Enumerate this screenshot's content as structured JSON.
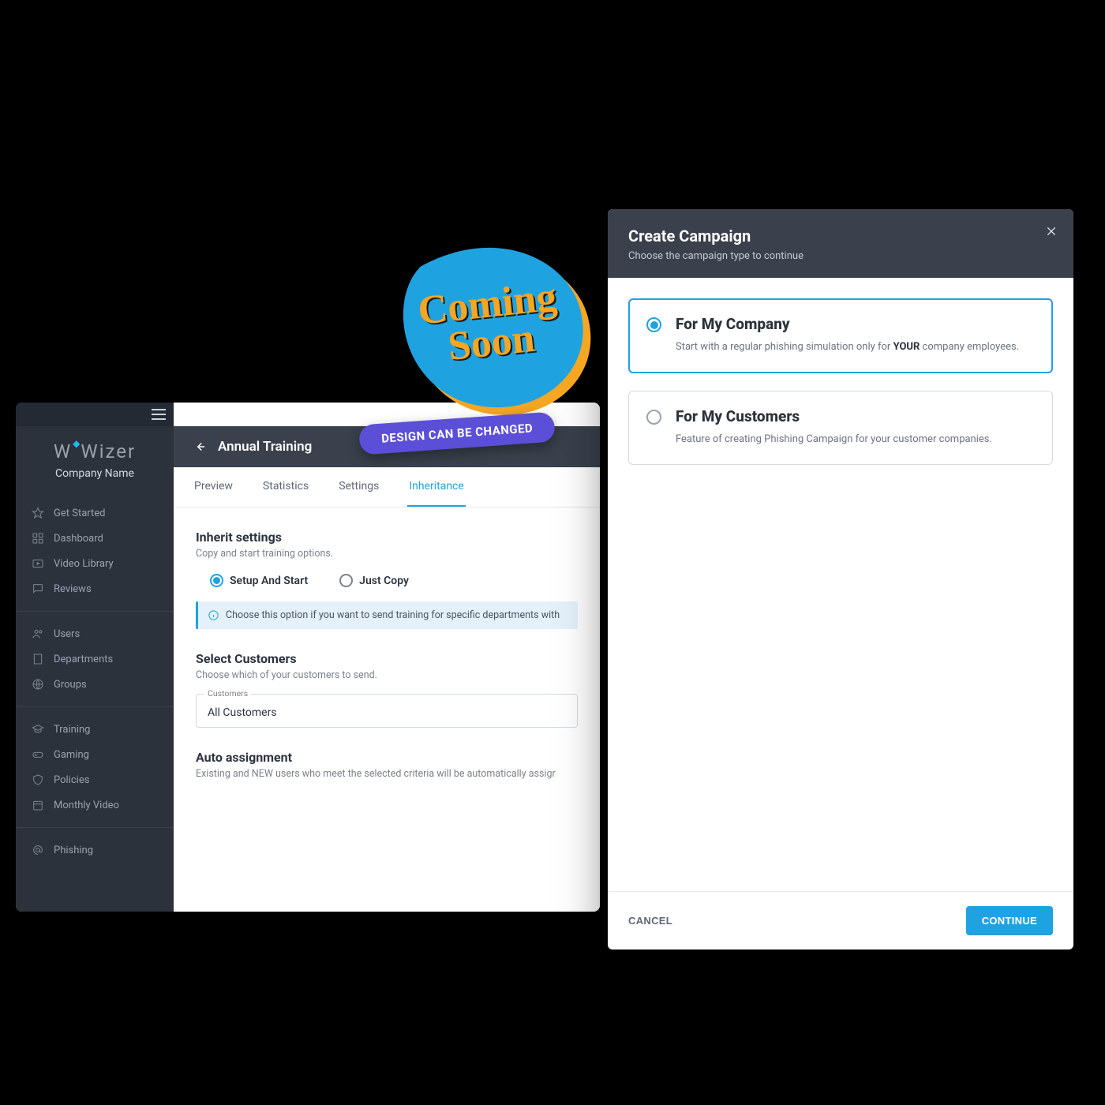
{
  "brand": {
    "name": "Wizer"
  },
  "company_name": "Company Name",
  "sidebar": {
    "groups": [
      {
        "items": [
          {
            "label": "Get Started",
            "icon": "star-icon"
          },
          {
            "label": "Dashboard",
            "icon": "grid-icon"
          },
          {
            "label": "Video Library",
            "icon": "play-icon"
          },
          {
            "label": "Reviews",
            "icon": "chat-icon"
          }
        ]
      },
      {
        "items": [
          {
            "label": "Users",
            "icon": "users-icon"
          },
          {
            "label": "Departments",
            "icon": "building-icon"
          },
          {
            "label": "Groups",
            "icon": "globe-icon"
          }
        ]
      },
      {
        "items": [
          {
            "label": "Training",
            "icon": "graduation-icon"
          },
          {
            "label": "Gaming",
            "icon": "gamepad-icon"
          },
          {
            "label": "Policies",
            "icon": "shield-icon"
          },
          {
            "label": "Monthly Video",
            "icon": "calendar-icon"
          }
        ]
      },
      {
        "items": [
          {
            "label": "Phishing",
            "icon": "at-icon"
          }
        ]
      }
    ]
  },
  "page": {
    "title": "Annual Training",
    "tabs": [
      {
        "label": "Preview",
        "active": false
      },
      {
        "label": "Statistics",
        "active": false
      },
      {
        "label": "Settings",
        "active": false
      },
      {
        "label": "Inheritance",
        "active": true
      }
    ],
    "inherit": {
      "title": "Inherit settings",
      "subtitle": "Copy and start training options.",
      "options": [
        {
          "label": "Setup And Start",
          "selected": true
        },
        {
          "label": "Just Copy",
          "selected": false
        }
      ],
      "info": "Choose this option if you want to send training for specific departments with"
    },
    "select_customers": {
      "title": "Select Customers",
      "subtitle": "Choose which of your customers to send.",
      "field_label": "Customers",
      "value": "All Customers"
    },
    "auto_assignment": {
      "title": "Auto assignment",
      "subtitle": "Existing and NEW users who meet the selected criteria will be automatically assigr"
    }
  },
  "modal": {
    "title": "Create Campaign",
    "subtitle": "Choose the campaign type to continue",
    "option_company": {
      "title": "For My Company",
      "desc_pre": "Start with a regular phishing simulation only for ",
      "desc_bold": "YOUR",
      "desc_post": " company employees."
    },
    "option_customers": {
      "title": "For My Customers",
      "desc": "Feature of creating Phishing Campaign for your customer companies."
    },
    "cancel": "CANCEL",
    "continue": "CONTINUE"
  },
  "badges": {
    "coming_soon": "Coming\nSoon",
    "design_note": "DESIGN CAN BE CHANGED"
  }
}
